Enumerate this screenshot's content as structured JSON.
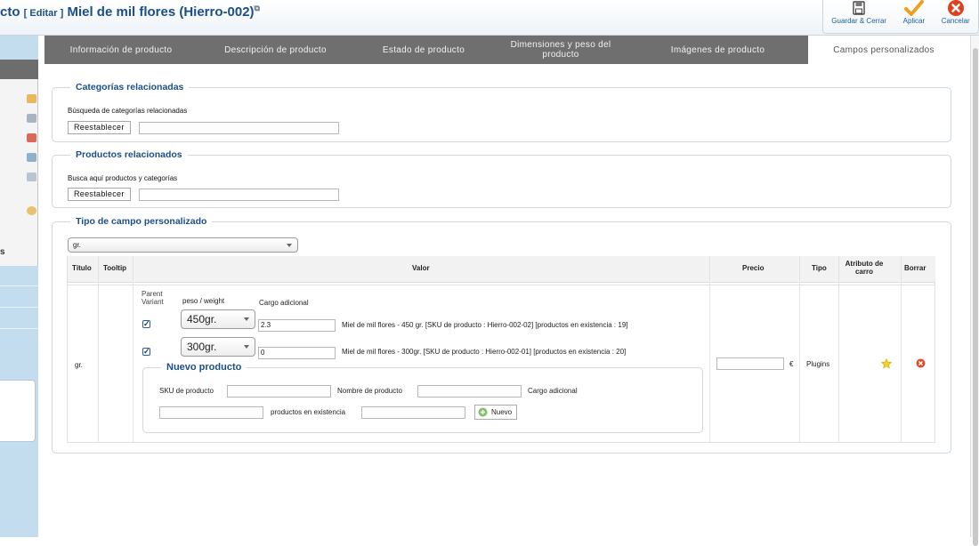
{
  "header": {
    "title_prefix": "cto",
    "edit_label": "[ Editar ]",
    "product_name": "Miel de mil flores (Hierro-002)",
    "toolbar": {
      "save_close_label": "Guardar & Cerrar",
      "apply_label": "Aplicar",
      "cancel_label": "Cancelar"
    }
  },
  "sidebar": {
    "section_letter": "s"
  },
  "tabs": [
    "Información de producto",
    "Descripción de producto",
    "Estado de producto",
    "Dimensiones y peso del producto",
    "Imágenes de producto",
    "Campos personalizados"
  ],
  "active_tab": "Campos personalizados",
  "related_categories": {
    "legend": "Categorías relacionadas",
    "search_label": "Búsqueda de categorías relacionadas",
    "reset_label": "Reestablecer",
    "input_value": ""
  },
  "related_products": {
    "legend": "Productos relacionados",
    "search_label": "Busca aquí productos y categorías",
    "reset_label": "Reestablecer",
    "input_value": ""
  },
  "custom_field": {
    "legend": "Tipo de campo personalizado",
    "type_select": "gr.",
    "columns": {
      "title": "Título",
      "tooltip": "Tooltip",
      "value": "Valor",
      "price": "Precio",
      "type": "Tipo",
      "cart_attr": "Atributo de carro",
      "delete": "Borrar"
    },
    "row": {
      "title": "gr.",
      "price_value": "",
      "currency": "€",
      "type": "Plugins",
      "value_headers": {
        "parent_variant": "Parent Variant",
        "weight": "peso / weight",
        "extra_charge": "Cargo adicional"
      },
      "variants": [
        {
          "checked": true,
          "weight": "450gr.",
          "charge": "2.3",
          "description": "Miel de mil flores - 450 gr. [SKU de producto : Hierro-002-02] [productos en existencia : 19]"
        },
        {
          "checked": true,
          "weight": "300gr.",
          "charge": "0",
          "description": "Miel de mil flores - 300gr. [SKU de producto : Hierro-002-01] [productos en existencia : 20]"
        }
      ],
      "new_product": {
        "legend": "Nuevo producto",
        "sku_label": "SKU de producto",
        "name_label": "Nombre de producto",
        "charge_label": "Cargo adicional",
        "stock_label": "productos en existencia",
        "new_button": "Nuevo"
      }
    }
  },
  "colors": {
    "title_blue": "#1b4f8a",
    "tab_bar": "#6f6f6f",
    "sidebar": "#c3dcee",
    "apply_orange": "#f0a020",
    "cancel_red": "#e04020"
  }
}
